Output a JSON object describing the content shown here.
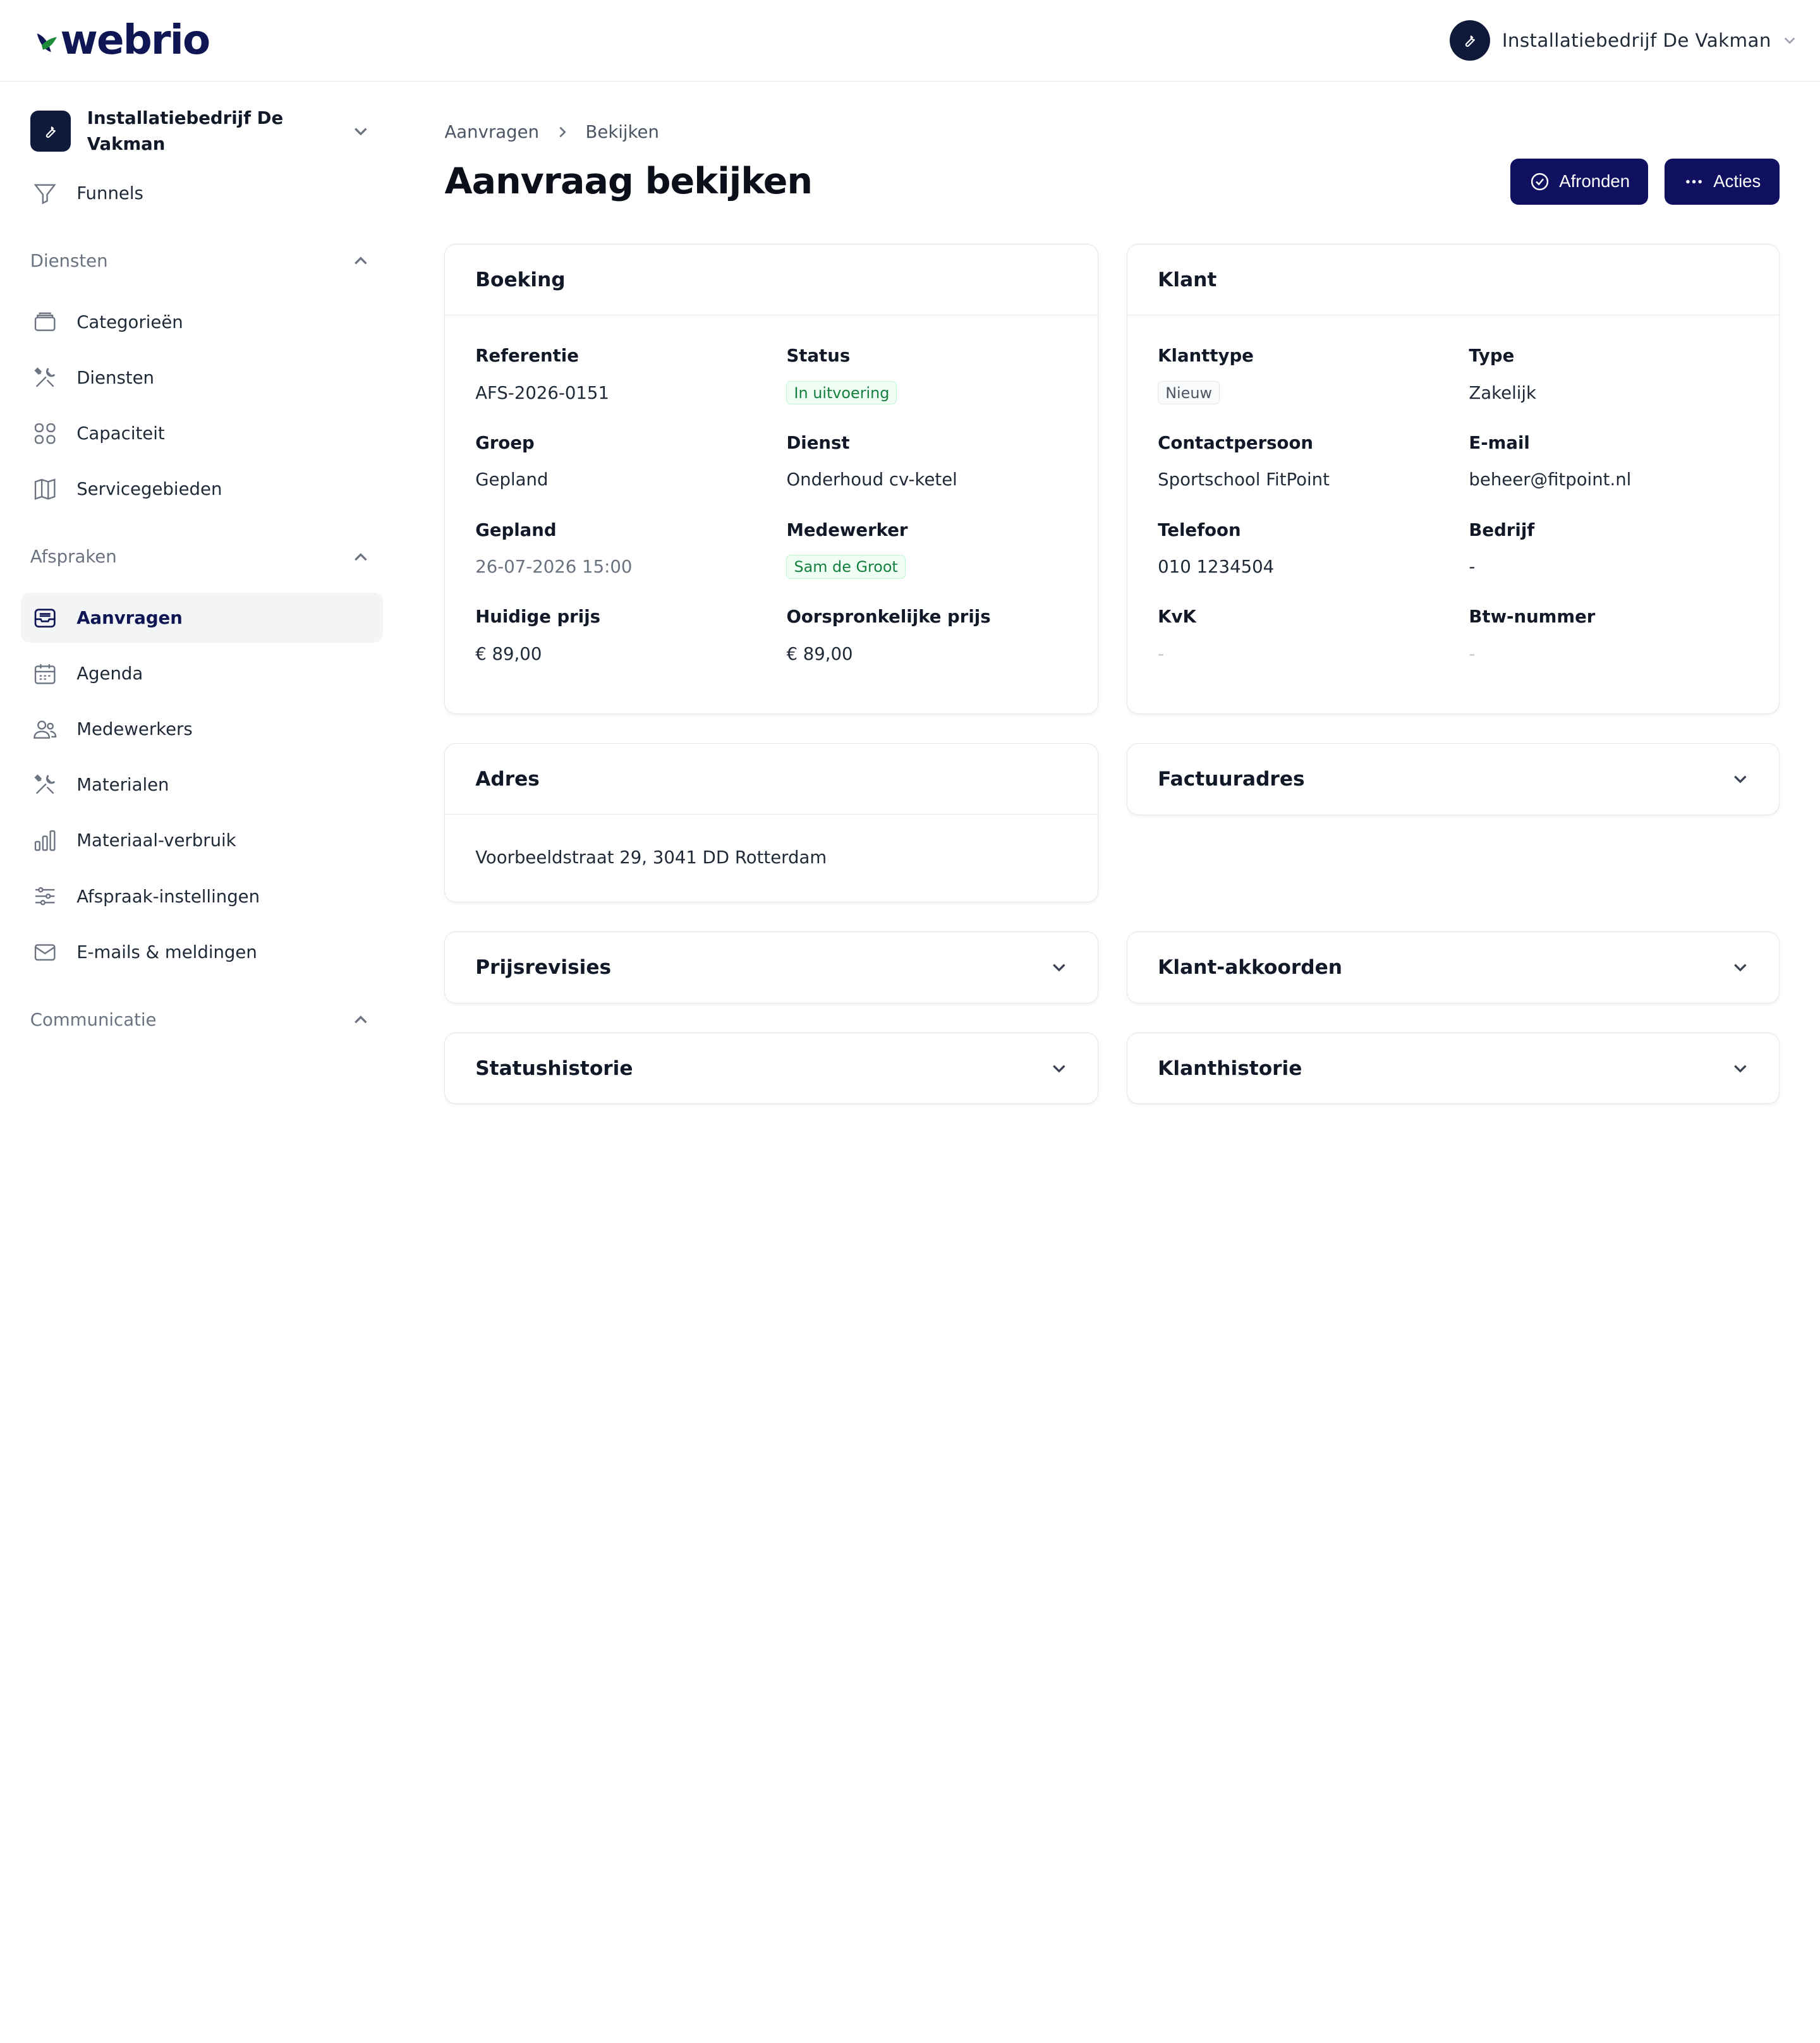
{
  "brand": {
    "name": "webrio",
    "primary": "#0f1160",
    "dark": "#0f1a3a",
    "leaf": "#1f8a3a"
  },
  "topbar": {
    "user_name": "Installatiebedrijf De Vakman"
  },
  "sidebar": {
    "org_name": "Installatiebedrijf De Vakman",
    "top_items": [
      {
        "label": "Funnels",
        "icon": "funnel-icon"
      }
    ],
    "sections": [
      {
        "title": "Diensten",
        "items": [
          {
            "label": "Categorieën",
            "icon": "box-icon"
          },
          {
            "label": "Diensten",
            "icon": "tools-icon"
          },
          {
            "label": "Capaciteit",
            "icon": "grid-icon"
          },
          {
            "label": "Servicegebieden",
            "icon": "map-icon"
          }
        ]
      },
      {
        "title": "Afspraken",
        "items": [
          {
            "label": "Aanvragen",
            "icon": "inbox-icon",
            "active": true
          },
          {
            "label": "Agenda",
            "icon": "calendar-icon"
          },
          {
            "label": "Medewerkers",
            "icon": "users-icon"
          },
          {
            "label": "Materialen",
            "icon": "tools-icon"
          },
          {
            "label": "Materiaal-verbruik",
            "icon": "bar-chart-icon"
          },
          {
            "label": "Afspraak-instellingen",
            "icon": "sliders-icon"
          },
          {
            "label": "E-mails & meldingen",
            "icon": "mail-icon"
          }
        ]
      },
      {
        "title": "Communicatie",
        "items": []
      }
    ]
  },
  "breadcrumb": {
    "parent": "Aanvragen",
    "current": "Bekijken"
  },
  "page": {
    "title": "Aanvraag bekijken"
  },
  "actions": {
    "complete": "Afronden",
    "more": "Acties"
  },
  "booking": {
    "title": "Boeking",
    "referentie_label": "Referentie",
    "referentie": "AFS-2026-0151",
    "status_label": "Status",
    "status": "In uitvoering",
    "groep_label": "Groep",
    "groep": "Gepland",
    "dienst_label": "Dienst",
    "dienst": "Onderhoud cv-ketel",
    "gepland_label": "Gepland",
    "gepland": "26-07-2026 15:00",
    "medewerker_label": "Medewerker",
    "medewerker": "Sam de Groot",
    "huidige_label": "Huidige prijs",
    "huidige": "€ 89,00",
    "oorspr_label": "Oorspronkelijke prijs",
    "oorspr": "€ 89,00"
  },
  "client": {
    "title": "Klant",
    "klanttype_label": "Klanttype",
    "klanttype": "Nieuw",
    "type_label": "Type",
    "type": "Zakelijk",
    "contact_label": "Contactpersoon",
    "contact": "Sportschool FitPoint",
    "email_label": "E-mail",
    "email": "beheer@fitpoint.nl",
    "tel_label": "Telefoon",
    "tel": "010 1234504",
    "bedrijf_label": "Bedrijf",
    "bedrijf": "-",
    "kvk_label": "KvK",
    "kvk": "-",
    "btw_label": "Btw-nummer",
    "btw": "-"
  },
  "address": {
    "title": "Adres",
    "value": "Voorbeeldstraat 29, 3041 DD Rotterdam"
  },
  "collapsed": {
    "factuuradres": "Factuuradres",
    "prijsrevisies": "Prijsrevisies",
    "klant_akkoorden": "Klant-akkoorden",
    "statushistorie": "Statushistorie",
    "klanthistorie": "Klanthistorie"
  }
}
